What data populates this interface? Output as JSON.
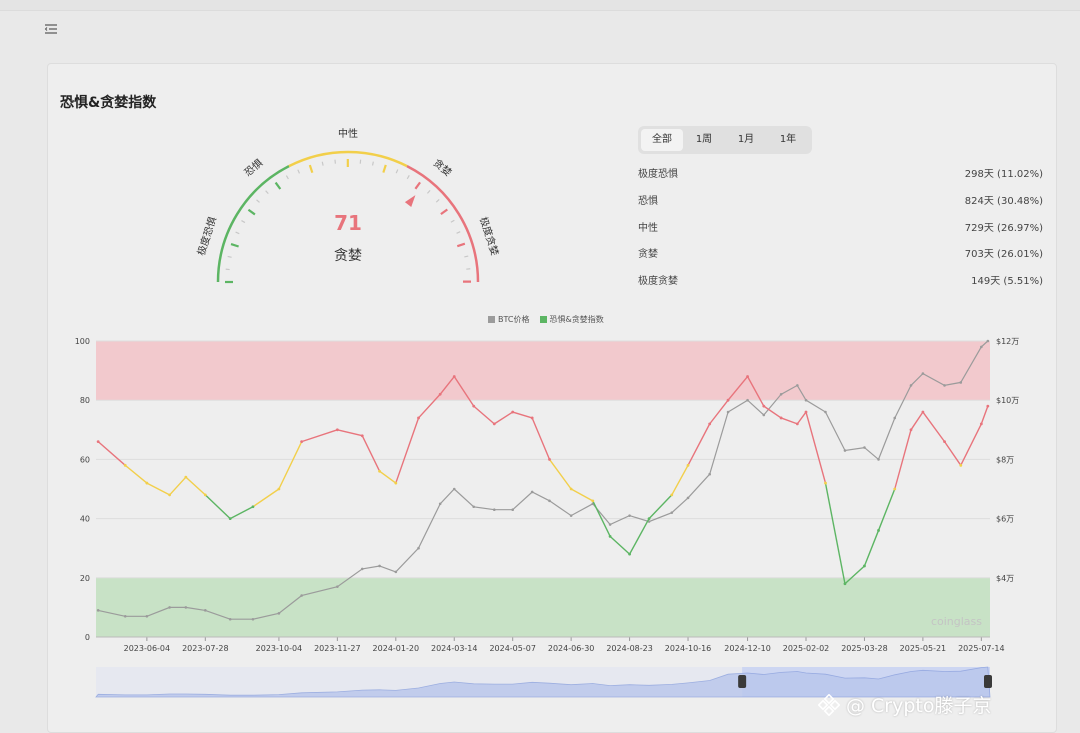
{
  "card": {
    "title": "恐惧&贪婪指数"
  },
  "gauge": {
    "value": "71",
    "label": "贪婪",
    "zone_labels": [
      "极度恐惧",
      "恐惧",
      "中性",
      "贪婪",
      "极度贪婪"
    ]
  },
  "tabs": [
    "全部",
    "1周",
    "1月",
    "1年"
  ],
  "active_tab": 0,
  "stats": [
    {
      "label": "极度恐惧",
      "value": "298天 (11.02%)"
    },
    {
      "label": "恐惧",
      "value": "824天 (30.48%)"
    },
    {
      "label": "中性",
      "value": "729天 (26.97%)"
    },
    {
      "label": "贪婪",
      "value": "703天 (26.01%)"
    },
    {
      "label": "极度贪婪",
      "value": "149天 (5.51%)"
    }
  ],
  "brand": "coinglass",
  "watermark": "@ Crypto滕子京",
  "colors": {
    "red": "#e8747c",
    "yellow": "#f2cf4a",
    "green": "#5cb563",
    "btc": "#9b9b9b",
    "extreme_greed_band": "#f2c9cd",
    "extreme_fear_band": "#c8e2c6"
  },
  "chart_data": {
    "type": "line",
    "legend": [
      "BTC价格",
      "恐惧&贪婪指数"
    ],
    "x_ticks": [
      "2023-06-04",
      "2023-07-28",
      "2023-10-04",
      "2023-11-27",
      "2024-01-20",
      "2024-03-14",
      "2024-05-07",
      "2024-06-30",
      "2024-08-23",
      "2024-10-16",
      "2024-12-10",
      "2025-02-02",
      "2025-03-28",
      "2025-05-21",
      "2025-07-14"
    ],
    "y_left_ticks": [
      "0",
      "20",
      "40",
      "60",
      "80",
      "100"
    ],
    "y_right_ticks": [
      "$4万",
      "$6万",
      "$8万",
      "$10万",
      "$12万"
    ],
    "ylim_left": [
      0,
      100
    ],
    "ylim_right": [
      2,
      12
    ],
    "bands": [
      {
        "from": 80,
        "to": 100,
        "name": "extreme-greed"
      },
      {
        "from": 0,
        "to": 20,
        "name": "extreme-fear"
      }
    ],
    "x_dates": [
      "2023-04-20",
      "2023-05-15",
      "2023-06-04",
      "2023-06-25",
      "2023-07-10",
      "2023-07-28",
      "2023-08-20",
      "2023-09-10",
      "2023-10-04",
      "2023-10-25",
      "2023-11-27",
      "2023-12-20",
      "2024-01-05",
      "2024-01-20",
      "2024-02-10",
      "2024-03-01",
      "2024-03-14",
      "2024-04-01",
      "2024-04-20",
      "2024-05-07",
      "2024-05-25",
      "2024-06-10",
      "2024-06-30",
      "2024-07-20",
      "2024-08-05",
      "2024-08-23",
      "2024-09-10",
      "2024-10-01",
      "2024-10-16",
      "2024-11-05",
      "2024-11-22",
      "2024-12-10",
      "2024-12-25",
      "2025-01-10",
      "2025-01-25",
      "2025-02-02",
      "2025-02-20",
      "2025-03-10",
      "2025-03-28",
      "2025-04-10",
      "2025-04-25",
      "2025-05-10",
      "2025-05-21",
      "2025-06-10",
      "2025-06-25",
      "2025-07-14",
      "2025-07-20"
    ],
    "series": [
      {
        "name": "恐惧&贪婪指数",
        "axis": "left",
        "values": [
          66,
          58,
          52,
          48,
          54,
          48,
          40,
          44,
          50,
          66,
          70,
          68,
          56,
          52,
          74,
          82,
          88,
          78,
          72,
          76,
          74,
          60,
          50,
          46,
          34,
          28,
          40,
          48,
          58,
          72,
          80,
          88,
          78,
          74,
          72,
          76,
          52,
          18,
          24,
          36,
          50,
          70,
          76,
          66,
          58,
          72,
          78
        ]
      },
      {
        "name": "BTC价格",
        "axis": "right",
        "values": [
          2.9,
          2.7,
          2.7,
          3.0,
          3.0,
          2.9,
          2.6,
          2.6,
          2.8,
          3.4,
          3.7,
          4.3,
          4.4,
          4.2,
          5.0,
          6.5,
          7.0,
          6.4,
          6.3,
          6.3,
          6.9,
          6.6,
          6.1,
          6.5,
          5.8,
          6.1,
          5.9,
          6.2,
          6.7,
          7.5,
          9.6,
          10.0,
          9.5,
          10.2,
          10.5,
          10.0,
          9.6,
          8.3,
          8.4,
          8.0,
          9.4,
          10.5,
          10.9,
          10.5,
          10.6,
          11.8,
          12.0
        ]
      }
    ]
  }
}
